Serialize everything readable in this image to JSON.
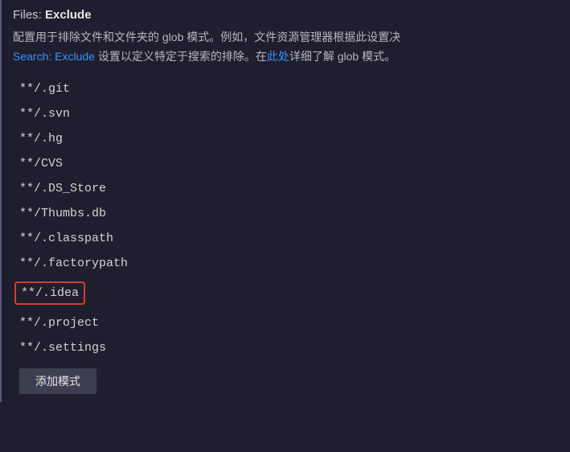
{
  "setting": {
    "category": "Files: ",
    "name": "Exclude",
    "description_part1": "配置用于排除文件和文件夹的 glob 模式。例如，文件资源管理器根据此设置决",
    "link1": "Search: Exclude",
    "description_part2": " 设置以定义特定于搜索的排除。在",
    "link2": "此处",
    "description_part3": "详细了解 glob 模式。"
  },
  "patterns": [
    "**/.git",
    "**/.svn",
    "**/.hg",
    "**/CVS",
    "**/.DS_Store",
    "**/Thumbs.db",
    "**/.classpath",
    "**/.factorypath",
    "**/.idea",
    "**/.project",
    "**/.settings"
  ],
  "highlighted_index": 8,
  "buttons": {
    "add_pattern": "添加模式"
  }
}
